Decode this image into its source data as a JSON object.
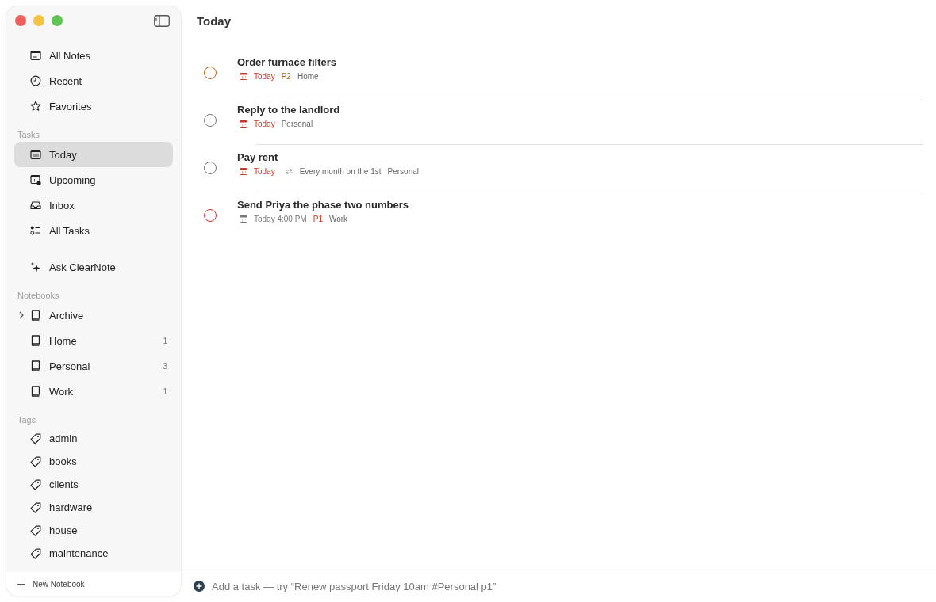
{
  "sidebar": {
    "library": [
      {
        "label": "All Notes",
        "kind": "notes",
        "selected": false
      },
      {
        "label": "Recent",
        "kind": "clock",
        "selected": false
      },
      {
        "label": "Favorites",
        "kind": "star",
        "selected": false
      }
    ],
    "tasks_heading": "Tasks",
    "tasks": [
      {
        "label": "Today",
        "kind": "calendar",
        "selected": true
      },
      {
        "label": "Upcoming",
        "kind": "calendar-clock",
        "selected": false
      },
      {
        "label": "Inbox",
        "kind": "inbox",
        "selected": false
      },
      {
        "label": "All Tasks",
        "kind": "checklist",
        "selected": false
      }
    ],
    "assistant": {
      "label": "Ask ClearNote",
      "selected": false
    },
    "notebooks_heading": "Notebooks",
    "notebooks": [
      {
        "label": "Archive",
        "expanded": false,
        "selected": false
      },
      {
        "label": "Home",
        "count": "1",
        "selected": false
      },
      {
        "label": "Personal",
        "count": "3",
        "selected": false
      },
      {
        "label": "Work",
        "count": "1",
        "selected": false
      }
    ],
    "tags_heading": "Tags",
    "tags": [
      {
        "label": "admin",
        "selected": false
      },
      {
        "label": "books",
        "selected": false
      },
      {
        "label": "clients",
        "selected": false
      },
      {
        "label": "hardware",
        "selected": false
      },
      {
        "label": "house",
        "selected": false
      },
      {
        "label": "maintenance",
        "selected": false
      }
    ],
    "new_notebook": "New Notebook"
  },
  "title": "Today",
  "tasks": [
    {
      "title": "Order furnace filters",
      "color": "#b5651d",
      "due": {
        "text": "Today",
        "color": "#c0392b"
      },
      "priority": {
        "text": "P2",
        "color": "#b5651d"
      },
      "notebook": "Home"
    },
    {
      "title": "Reply to the landlord",
      "color": "#777777",
      "due": {
        "text": "Today",
        "color": "#c0392b"
      },
      "notebook": "Personal"
    },
    {
      "title": "Pay rent",
      "color": "#777777",
      "due": {
        "text": "Today",
        "color": "#c0392b"
      },
      "repeat": "Every month on the 1st",
      "notebook": "Personal"
    },
    {
      "title": "Send Priya the phase two numbers",
      "color": "#c0392b",
      "due": {
        "text": "Today 4:00 PM",
        "color": "#777777"
      },
      "priority": {
        "text": "P1",
        "color": "#c0392b"
      },
      "notebook": "Work"
    }
  ],
  "add_task": {
    "placeholder": "Add a task — try “Renew passport Friday 10am #Personal p1”"
  }
}
